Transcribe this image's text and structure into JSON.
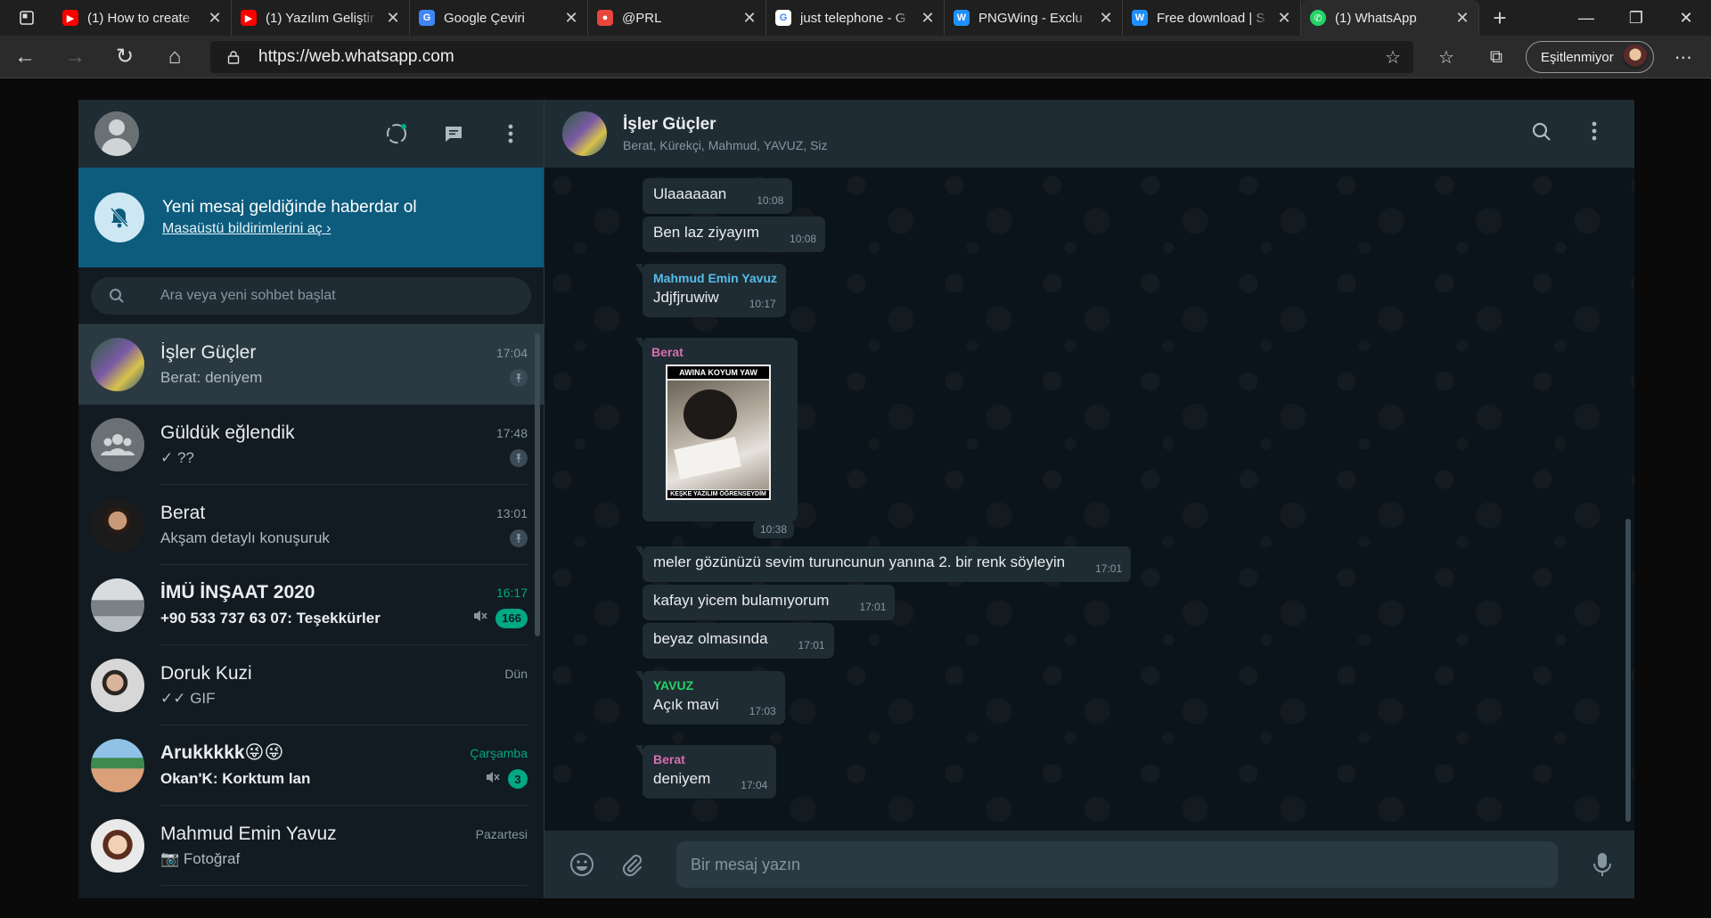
{
  "browser": {
    "tabs": [
      {
        "title": "(1) How to create",
        "favicon": "youtube-icon",
        "color": "#ff0000",
        "active": false
      },
      {
        "title": "(1) Yazılım Geliştir",
        "favicon": "youtube-icon",
        "color": "#ff0000",
        "active": false
      },
      {
        "title": "Google Çeviri",
        "favicon": "google-translate-icon",
        "color": "#4285f4",
        "active": false
      },
      {
        "title": "@PRL",
        "favicon": "app-icon",
        "color": "#e8453c",
        "active": false
      },
      {
        "title": "just telephone - G",
        "favicon": "google-icon",
        "color": "#ffffff",
        "active": false
      },
      {
        "title": "PNGWing - Exclu",
        "favicon": "pngwing-icon",
        "color": "#1e90ff",
        "active": false
      },
      {
        "title": "Free download | S",
        "favicon": "pngwing-icon",
        "color": "#1e90ff",
        "active": false
      },
      {
        "title": "(1) WhatsApp",
        "favicon": "whatsapp-icon",
        "color": "#25d366",
        "active": true
      }
    ],
    "url": "https://web.whatsapp.com",
    "sync_label": "Eşitlenmiyor"
  },
  "sidebar": {
    "notification": {
      "title": "Yeni mesaj geldiğinde haberdar ol",
      "link": "Masaüstü bildirimlerini aç ›"
    },
    "search_placeholder": "Ara veya yeni sohbet başlat",
    "chats": [
      {
        "name": "İşler Güçler",
        "last": "Berat: deniyem",
        "time": "17:04",
        "pinned": true,
        "active": true,
        "unread": ""
      },
      {
        "name": "Güldük eğlendik",
        "last": "✓ ??",
        "time": "17:48",
        "pinned": true,
        "active": false,
        "unread": ""
      },
      {
        "name": "Berat",
        "last": "Akşam detaylı konuşuruk",
        "time": "13:01",
        "pinned": true,
        "active": false,
        "unread": ""
      },
      {
        "name": "İMÜ İNŞAAT 2020",
        "last": "+90 533 737 63 07: Teşekkürler",
        "time": "16:17",
        "pinned": false,
        "active": false,
        "muted": true,
        "unread": "166"
      },
      {
        "name": "Doruk Kuzi",
        "last": "✓✓ GIF",
        "time": "Dün",
        "pinned": false,
        "active": false,
        "unread": ""
      },
      {
        "name": "Arukkkkk😜😜",
        "last": "Okan'K: Korktum lan",
        "time": "Çarşamba",
        "pinned": false,
        "active": false,
        "muted": true,
        "unread": "3"
      },
      {
        "name": "Mahmud Emin Yavuz",
        "last": "📷 Fotoğraf",
        "time": "Pazartesi",
        "pinned": false,
        "active": false,
        "unread": ""
      }
    ]
  },
  "conversation": {
    "name": "İşler Güçler",
    "members": "Berat, Kürekçi, Mahmud, YAVUZ, Siz",
    "messages": [
      {
        "sender": "",
        "text": "Ulaaaaaan",
        "time": "10:08"
      },
      {
        "sender": "",
        "text": "Ben laz ziyayım",
        "time": "10:08"
      },
      {
        "sender": "Mahmud Emin Yavuz",
        "sender_color": "#53bdeb",
        "text": "Jdjfjruwiw",
        "time": "10:17"
      },
      {
        "sender": "Berat",
        "sender_color": "#d66fb1",
        "image_top": "AWINA KOYUM YAW",
        "image_bottom": "KEŞKE YAZILIM ÖĞRENSEYDİM",
        "time": "10:38"
      },
      {
        "sender": "",
        "text": "meler gözünüzü sevim turuncunun yanına 2. bir renk söyleyin",
        "time": "17:01"
      },
      {
        "sender": "",
        "text": "kafayı yicem bulamıyorum",
        "time": "17:01"
      },
      {
        "sender": "",
        "text": "beyaz olmasında",
        "time": "17:01"
      },
      {
        "sender": "YAVUZ",
        "sender_color": "#25d366",
        "text": "Açık mavi",
        "time": "17:03"
      },
      {
        "sender": "Berat",
        "sender_color": "#d66fb1",
        "text": "deniyem",
        "time": "17:04"
      }
    ],
    "composer_placeholder": "Bir mesaj yazın"
  }
}
